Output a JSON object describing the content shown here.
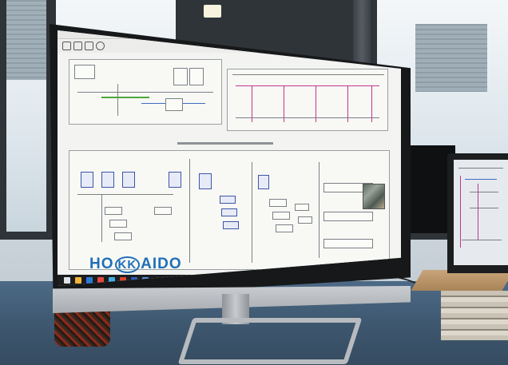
{
  "photo": {
    "type": "photograph",
    "screen_logo": "HOKKAIDO"
  }
}
